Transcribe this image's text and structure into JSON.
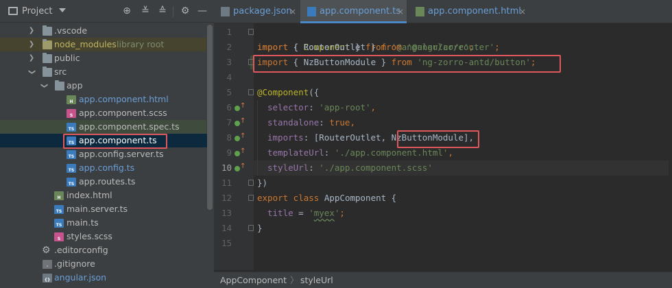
{
  "project_panel": {
    "title": "Project",
    "header_icons": [
      "locate-icon",
      "expand-all-icon",
      "collapse-all-icon",
      "gear-icon",
      "hide-icon"
    ],
    "tree": [
      {
        "label": ".vscode",
        "type": "folder",
        "state": "collapsed"
      },
      {
        "label": "node_modules",
        "hint": "library root",
        "type": "folder",
        "state": "collapsed"
      },
      {
        "label": "public",
        "type": "folder",
        "state": "collapsed"
      },
      {
        "label": "src",
        "type": "folder",
        "state": "expanded"
      },
      {
        "label": "app",
        "type": "folder",
        "state": "expanded"
      },
      {
        "label": "app.component.html",
        "type": "html"
      },
      {
        "label": "app.component.scss",
        "type": "scss"
      },
      {
        "label": "app.component.spec.ts",
        "type": "ts"
      },
      {
        "label": "app.component.ts",
        "type": "ts",
        "selected": true
      },
      {
        "label": "app.config.server.ts",
        "type": "ts"
      },
      {
        "label": "app.config.ts",
        "type": "ts"
      },
      {
        "label": "app.routes.ts",
        "type": "ts"
      },
      {
        "label": "index.html",
        "type": "html"
      },
      {
        "label": "main.server.ts",
        "type": "ts"
      },
      {
        "label": "main.ts",
        "type": "ts"
      },
      {
        "label": "styles.scss",
        "type": "scss"
      },
      {
        "label": ".editorconfig",
        "type": "config"
      },
      {
        "label": ".gitignore",
        "type": "config"
      },
      {
        "label": "angular.json",
        "type": "json"
      }
    ]
  },
  "tabs": [
    {
      "label": "package.json",
      "close": "×",
      "active": false
    },
    {
      "label": "app.component.ts",
      "close": "×",
      "active": true
    },
    {
      "label": "app.component.html",
      "close": "×",
      "active": false
    }
  ],
  "editor": {
    "line_numbers": [
      "1",
      "2",
      "3",
      "4",
      "5",
      "6",
      "7",
      "8",
      "9",
      "10",
      "11",
      "12",
      "13",
      "14",
      "15"
    ],
    "current_line": "10",
    "code": {
      "l1": {
        "kw": "import",
        "p1": " { ",
        "ty": "Component",
        "p2": " } ",
        "kw2": "from",
        "sp": " ",
        "st": "'@angular/core'",
        "end": ";"
      },
      "l2": {
        "kw": "import",
        "p1": " { RouterOutlet } ",
        "kw2": "from",
        "sp": " ",
        "st": "'@angular/router'",
        "end": ";"
      },
      "l3": {
        "kw": "import",
        "p1": " { NzButtonModule } ",
        "kw2": "from",
        "sp": " ",
        "st": "'ng-zorro-antd/button'",
        "end": ";"
      },
      "l5": {
        "an": "@Component",
        "p": "({"
      },
      "l6": {
        "pr": "selector",
        "p": ": ",
        "st": "'app-root'",
        "end": ","
      },
      "l7": {
        "pr": "standalone",
        "p": ": ",
        "kw": "true",
        "end": ","
      },
      "l8": {
        "pr": "imports",
        "p": ": [RouterOutlet, ",
        "mod": "NzButtonModule",
        "end": "],"
      },
      "l9": {
        "pr": "templateUrl",
        "p": ": ",
        "st": "'./app.component.html'",
        "end": ","
      },
      "l10": {
        "pr": "styleUrl",
        "p": ": ",
        "st": "'./app.component.scss'"
      },
      "l11": {
        "p": "})"
      },
      "l12": {
        "kw": "export class",
        "sp": " ",
        "cls": "AppComponent",
        "p": " {"
      },
      "l13": {
        "pr": "title",
        "p": " = ",
        "q1": "'",
        "st": "myex",
        "q2": "'",
        "end": ";"
      },
      "l14": {
        "p": "}"
      }
    }
  },
  "breadcrumb": {
    "items": [
      "AppComponent",
      "styleUrl"
    ],
    "separator": "〉"
  },
  "colors": {
    "keyword": "#cc7832",
    "string": "#6a8759",
    "annotation": "#bbb529",
    "property": "#9876aa",
    "highlight_box": "#e0585e",
    "selection": "#0d293e"
  }
}
